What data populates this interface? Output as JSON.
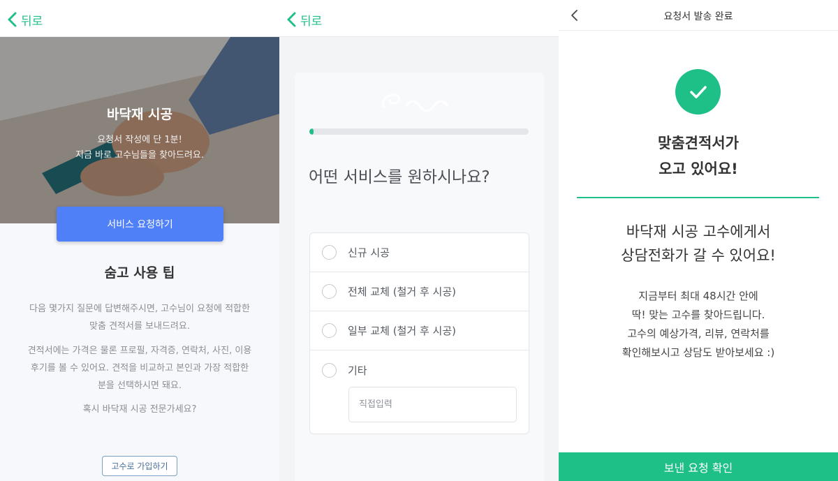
{
  "panel1": {
    "back_label": "뒤로",
    "hero": {
      "title": "바닥재 시공",
      "subtitle_line1": "요청서 작성에 단 1분!",
      "subtitle_line2": "지금 바로 고수님들을 찾아드려요."
    },
    "cta_label": "서비스 요청하기",
    "tips": {
      "title": "숨고 사용 팁",
      "para1_line1": "다음 몇가지 질문에 답변해주시면, 고수님이 요청에 적합한",
      "para1_line2": "맞춤 견적서를 보내드려요.",
      "para2_line1": "견적서에는 가격은 물론 프로필, 자격증, 연락처, 사진, 이용",
      "para2_line2": "후기를 볼 수 있어요. 견적을 비교하고 본인과 가장 적합한",
      "para2_line3": "분을 선택하시면 돼요.",
      "pro_question": "혹시 바닥재 시공 전문가세요?"
    },
    "join_label": "고수로 가입하기"
  },
  "panel2": {
    "back_label": "뒤로",
    "progress": 0.02,
    "question": "어떤 서비스를 원하시나요?",
    "options": [
      "신규 시공",
      "전체 교체 (철거 후 시공)",
      "일부 교체 (철거 후 시공)",
      "기타"
    ],
    "direct_input_placeholder": "직접입력"
  },
  "panel3": {
    "title": "요청서 발송 완료",
    "headline_line1": "맞춤견적서가",
    "headline_line2": "오고 있어요!",
    "message_line1": "바닥재 시공 고수에게서",
    "message_line2": "상담전화가 갈 수 있어요!",
    "info_line1": "지금부터 최대 48시간 안에",
    "info_line2": "딱! 맞는 고수를 찾아드립니다.",
    "info_line3": "고수의 예상가격, 리뷰, 연락처를",
    "info_line4": "확인해보시고 상담도 받아보세요 :)",
    "confirm_label": "보낸 요청 확인"
  },
  "colors": {
    "brand_green": "#1fbf88",
    "cta_blue": "#4f80f7",
    "text_dark": "#333333",
    "text_muted": "#8a8e96"
  },
  "icons": [
    "chevron-left-icon",
    "check-icon",
    "radio-icon"
  ]
}
